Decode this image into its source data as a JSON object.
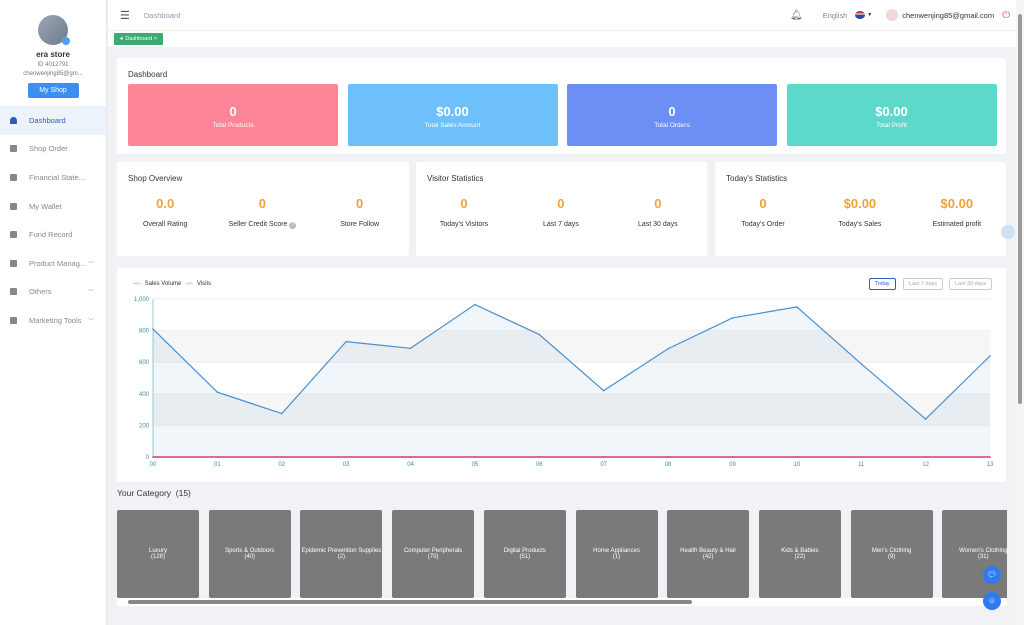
{
  "sidebar": {
    "store_name": "era store",
    "store_id": "ID 4012791",
    "email": "chenwenjing85@gm...",
    "my_shop": "My Shop",
    "items": [
      {
        "label": "Dashboard",
        "icon": "dashboard-icon"
      },
      {
        "label": "Shop Order",
        "icon": "clipboard-icon"
      },
      {
        "label": "Financial State...",
        "icon": "chart-icon"
      },
      {
        "label": "My Wallet",
        "icon": "wallet-icon"
      },
      {
        "label": "Fund Record",
        "icon": "record-icon"
      },
      {
        "label": "Product Manag...",
        "icon": "briefcase-icon"
      },
      {
        "label": "Others",
        "icon": "grid-icon"
      },
      {
        "label": "Marketing Tools",
        "icon": "bar-chart-icon"
      }
    ]
  },
  "header": {
    "breadcrumb": "Dashboard",
    "language": "English",
    "user_email": "chenwenjing85@gmail.com",
    "tag": "Dashboard"
  },
  "dashboard": {
    "title": "Dashboard",
    "stats": [
      {
        "value": "0",
        "label": "Total Products",
        "color": "#fc8598"
      },
      {
        "value": "$0.00",
        "label": "Total Sales Amount",
        "color": "#6ec0fb"
      },
      {
        "value": "0",
        "label": "Total Orders",
        "color": "#6d8ff5"
      },
      {
        "value": "$0.00",
        "label": "Total Profit",
        "color": "#5dd9cc"
      }
    ]
  },
  "shop_overview": {
    "title": "Shop Overview",
    "items": [
      {
        "value": "0.0",
        "label": "Overall Rating"
      },
      {
        "value": "0",
        "label": "Seller Credit Score"
      },
      {
        "value": "0",
        "label": "Store Follow"
      }
    ]
  },
  "visitor_stats": {
    "title": "Visitor Statistics",
    "items": [
      {
        "value": "0",
        "label": "Today's Visitors"
      },
      {
        "value": "0",
        "label": "Last 7 days"
      },
      {
        "value": "0",
        "label": "Last 30 days"
      }
    ]
  },
  "today_stats": {
    "title": "Today's Statistics",
    "items": [
      {
        "value": "0",
        "label": "Today's Order"
      },
      {
        "value": "$0.00",
        "label": "Today's Sales"
      },
      {
        "value": "$0.00",
        "label": "Estimated profit"
      }
    ]
  },
  "range_buttons": [
    "Today",
    "Last 7 days",
    "Last 30 days"
  ],
  "chart_data": {
    "type": "line",
    "x": [
      "00",
      "01",
      "02",
      "03",
      "04",
      "05",
      "06",
      "07",
      "08",
      "09",
      "10",
      "11",
      "12",
      "13"
    ],
    "series": [
      {
        "name": "Sales Volume",
        "color": "#d63a7a",
        "values": [
          0,
          0,
          0,
          0,
          0,
          0,
          0,
          0,
          0,
          0,
          0,
          0,
          0,
          0
        ]
      },
      {
        "name": "Visits",
        "color": "#4a8fcf",
        "values": [
          810,
          410,
          275,
          730,
          688,
          965,
          775,
          420,
          685,
          880,
          950,
          590,
          240,
          640
        ]
      }
    ],
    "ylim": [
      0,
      1000
    ],
    "yticks": [
      "0",
      "200",
      "400",
      "600",
      "800",
      "1,000"
    ],
    "grid": true,
    "legend": "top-left"
  },
  "category": {
    "title": "Your Category",
    "count": "(15)",
    "items": [
      {
        "name": "Luxury",
        "count": "(126)"
      },
      {
        "name": "Sports & Outdoors",
        "count": "(40)"
      },
      {
        "name": "Epidemic Prevention Supplies",
        "count": "(2)"
      },
      {
        "name": "Computer Peripherals",
        "count": "(70)"
      },
      {
        "name": "Digital Products",
        "count": "(51)"
      },
      {
        "name": "Home Appliances",
        "count": "(1)"
      },
      {
        "name": "Health Beauty & Hair",
        "count": "(42)"
      },
      {
        "name": "Kids & Babies",
        "count": "(22)"
      },
      {
        "name": "Men's Clothing",
        "count": "(9)"
      },
      {
        "name": "Women's Clothing",
        "count": "(31)"
      }
    ]
  }
}
